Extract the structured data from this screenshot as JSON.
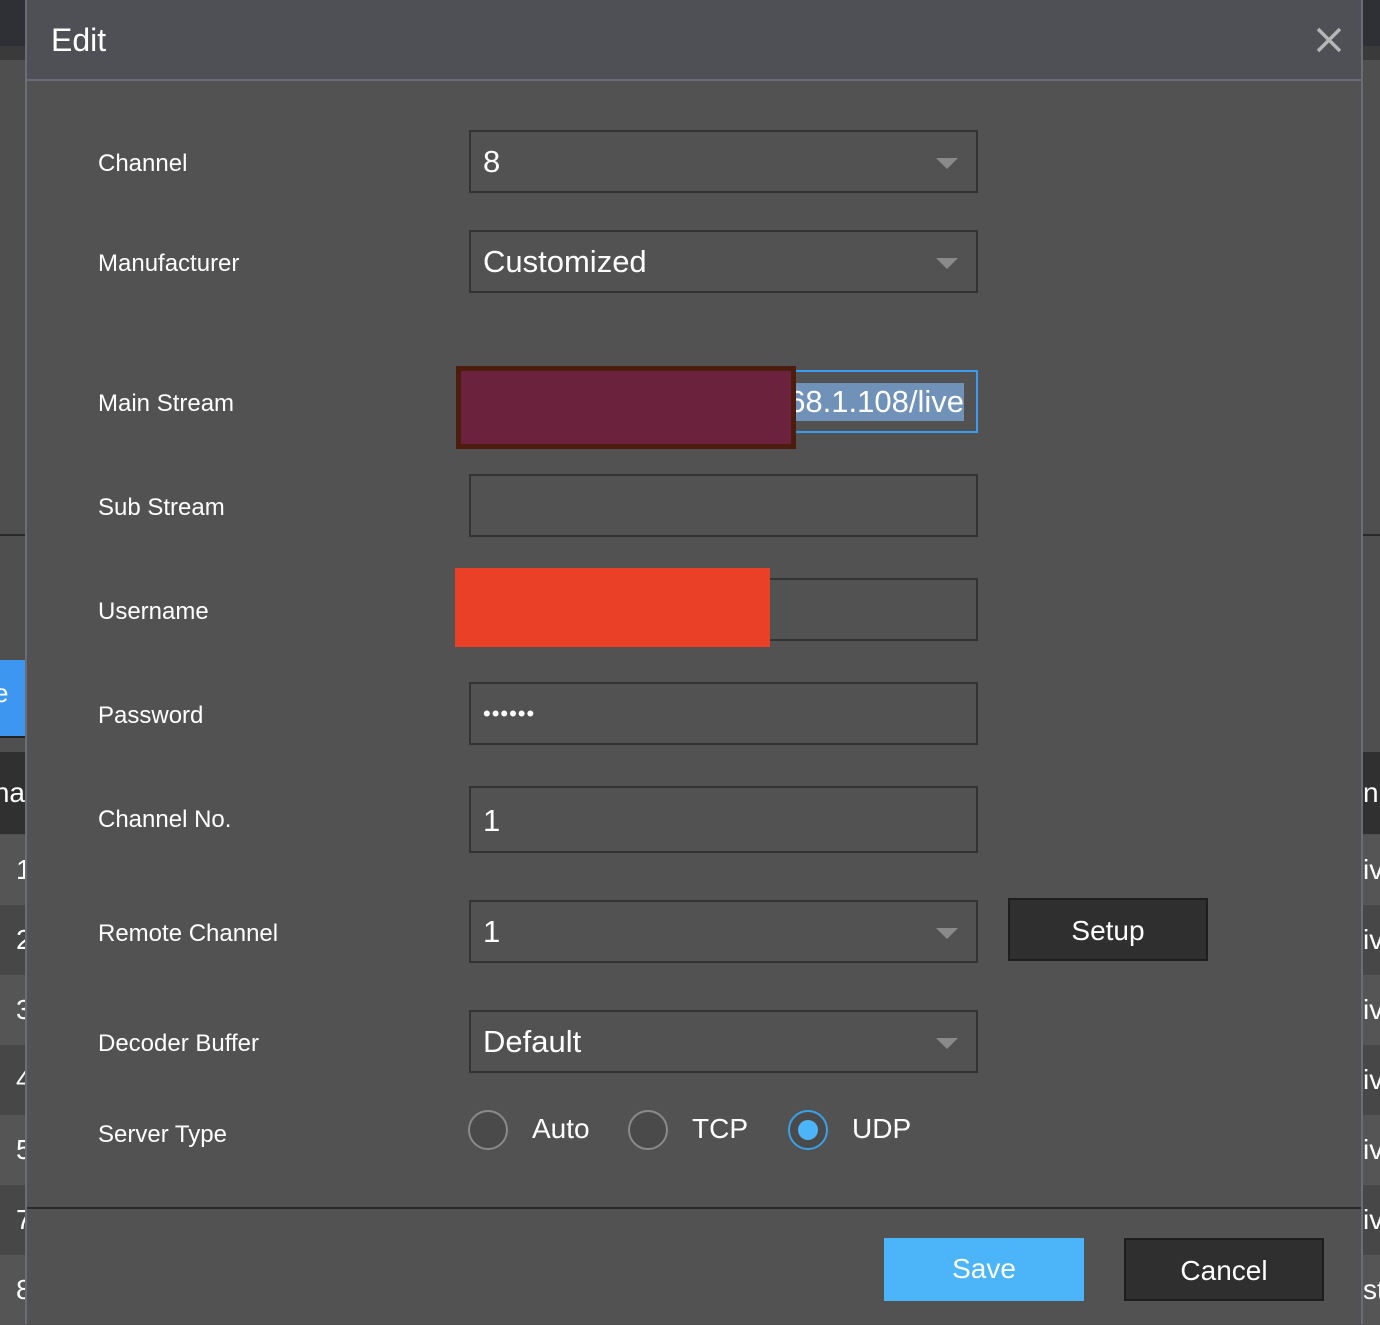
{
  "background": {
    "left_header": "na",
    "right_header": "nu",
    "left_rows": [
      "1",
      "2",
      "3",
      "4",
      "5",
      "7",
      "8"
    ],
    "right_rows": [
      "iv",
      "iv",
      "iv",
      "iv",
      "iv",
      "iv",
      "st"
    ],
    "left_button": "e"
  },
  "dialog": {
    "title": "Edit",
    "fields": {
      "channel": {
        "label": "Channel",
        "value": "8"
      },
      "manufacturer": {
        "label": "Manufacturer",
        "value": "Customized"
      },
      "main_stream": {
        "label": "Main Stream",
        "value": "68.1.108/live"
      },
      "sub_stream": {
        "label": "Sub Stream",
        "value": ""
      },
      "username": {
        "label": "Username",
        "value": ""
      },
      "password": {
        "label": "Password",
        "value": "••••••"
      },
      "channel_no": {
        "label": "Channel No.",
        "value": "1"
      },
      "remote_channel": {
        "label": "Remote Channel",
        "value": "1"
      },
      "decoder_buffer": {
        "label": "Decoder Buffer",
        "value": "Default"
      },
      "server_type": {
        "label": "Server Type",
        "options": [
          "Auto",
          "TCP",
          "UDP"
        ],
        "selected": "UDP"
      }
    },
    "setup_label": "Setup",
    "save_label": "Save",
    "cancel_label": "Cancel",
    "colors": {
      "accent": "#4cb4f8",
      "save": "#4cb4f8",
      "redaction_main": "#6b233d",
      "redaction_user": "#e94027"
    }
  }
}
